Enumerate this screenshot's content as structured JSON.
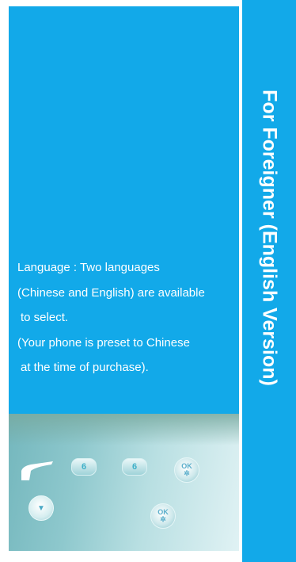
{
  "side_title": "For Foreigner (English Version)",
  "body_lines": [
    "Language : Two languages",
    "(Chinese and English) are available",
    "to select.",
    "(Your phone is preset to Chinese",
    "at the time of purchase)."
  ],
  "keys": {
    "num_key_1": "6",
    "num_key_2": "6",
    "ok_key_1": "OK",
    "ok_key_2": "OK"
  },
  "colors": {
    "accent": "#12a9e9",
    "text": "#ffffff"
  }
}
